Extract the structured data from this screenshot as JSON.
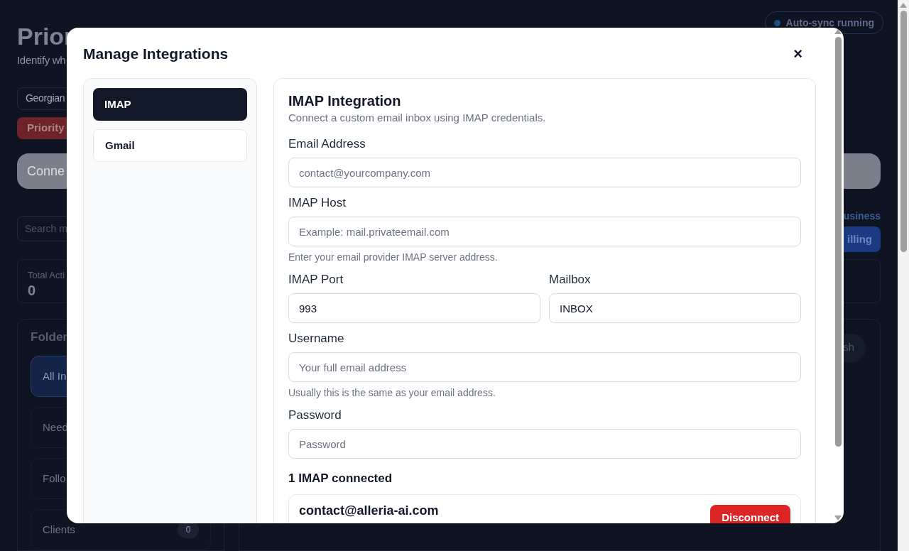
{
  "background": {
    "title": "Prior",
    "subtitle": "Identify wh",
    "account_button": "Georgian",
    "priority_button": "Priority",
    "connect_banner": "Conne",
    "search": {
      "placeholder": "Search m"
    },
    "stat": {
      "label": "Total Acti",
      "value": "0"
    },
    "folders": {
      "title": "Folder",
      "items": [
        {
          "label": "All In",
          "selected": true
        },
        {
          "label": "Need",
          "selected": false
        },
        {
          "label": "Follo",
          "selected": false
        },
        {
          "label": "Clients",
          "count": "0",
          "selected": false
        }
      ]
    },
    "sync_status": "Auto-sync running",
    "plan_label": "usiness",
    "billing_button": "illing",
    "refresh_button": "sh"
  },
  "dialog": {
    "title": "Manage Integrations",
    "close": "×",
    "tabs": [
      {
        "label": "IMAP",
        "selected": true
      },
      {
        "label": "Gmail",
        "selected": false
      }
    ],
    "panel": {
      "title": "IMAP Integration",
      "description": "Connect a custom email inbox using IMAP credentials.",
      "field_rows": [
        [
          {
            "label": "Email Address",
            "placeholder": "contact@yourcompany.com"
          }
        ],
        [
          {
            "label": "IMAP Host",
            "placeholder": "Example: mail.privateemail.com",
            "help": "Enter your email provider IMAP server address."
          }
        ],
        [
          {
            "label": "IMAP Port",
            "value": "993"
          },
          {
            "label": "Mailbox",
            "value": "INBOX"
          }
        ],
        [
          {
            "label": "Username",
            "placeholder": "Your full email address",
            "help": "Usually this is the same as your email address."
          }
        ],
        [
          {
            "label": "Password",
            "placeholder": "Password"
          }
        ]
      ],
      "connected": {
        "heading": "1 IMAP connected",
        "accounts": [
          {
            "email": "contact@alleria-ai.com",
            "action": "Disconnect"
          }
        ]
      }
    }
  }
}
